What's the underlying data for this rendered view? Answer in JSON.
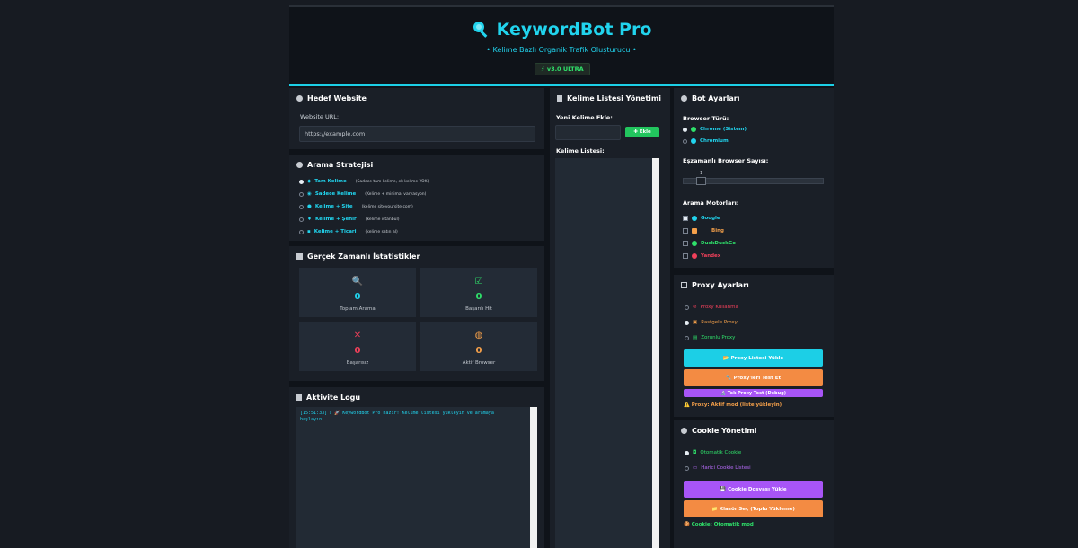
{
  "app": {
    "title": "KeywordBot Pro",
    "subtitle": "• Kelime Bazlı Organik Trafik Oluşturucu •",
    "version": "⚡ v3.0 ULTRA",
    "accent": "#21d4ee"
  },
  "target": {
    "title": "Hedef Website",
    "url_label": "Website URL:",
    "url_value": "https://example.com"
  },
  "strategy": {
    "title": "Arama Stratejisi",
    "options": [
      {
        "label": "Tam Kelime",
        "desc": "(Sadece tam kelime, ek kelime YOK)",
        "selected": true
      },
      {
        "label": "Sadece Kelime",
        "desc": "(Kelime + minimal varyasyon)",
        "selected": false
      },
      {
        "label": "Kelime + Site",
        "desc": "(kelime siteyoursite.com)",
        "selected": false
      },
      {
        "label": "Kelime + Şehir",
        "desc": "(kelime istanbul)",
        "selected": false
      },
      {
        "label": "Kelime + Ticari",
        "desc": "(kelime satın al)",
        "selected": false
      }
    ]
  },
  "stats": {
    "title": "Gerçek Zamanlı İstatistikler",
    "items": [
      {
        "label": "Toplam Arama",
        "value": "0",
        "color": "#21d4ee",
        "icon": "magnifier-icon"
      },
      {
        "label": "Başarılı Hit",
        "value": "0",
        "color": "#2fe06a",
        "icon": "check-box-icon"
      },
      {
        "label": "Başarısız",
        "value": "0",
        "color": "#f0405a",
        "icon": "cross-icon"
      },
      {
        "label": "Aktif Browser",
        "value": "0",
        "color": "#f5a04a",
        "icon": "globe-icon"
      }
    ]
  },
  "log": {
    "title": "Aktivite Logu",
    "line1": "[15:51:33] ℹ    🚀 KeywordBot Pro hazır! Kelime listesi yükleyin ve aramaya",
    "line2": "başlayın."
  },
  "keywords": {
    "title": "Kelime Listesi Yönetimi",
    "add_label": "Yeni Kelime Ekle:",
    "add_value": "",
    "add_button": "✚ Ekle",
    "list_label": "Kelime Listesi:"
  },
  "bot": {
    "title": "Bot Ayarları",
    "browser_type_label": "Browser Türü:",
    "browsers": [
      {
        "label": "Chrome (Sistem)",
        "selected": true
      },
      {
        "label": "Chromium",
        "selected": false
      }
    ],
    "concurrent_label": "Eşzamanlı Browser Sayısı:",
    "concurrent_value": "1",
    "concurrent_fraction": 0.0,
    "engines_label": "Arama Motorları:",
    "engines": [
      {
        "label": "Google",
        "checked": true,
        "color": "#21d4ee"
      },
      {
        "label": "Bing",
        "checked": false,
        "color": "#f5a04a"
      },
      {
        "label": "DuckDuckGo",
        "checked": false,
        "color": "#2fe06a"
      },
      {
        "label": "Yandex",
        "checked": false,
        "color": "#f0405a"
      }
    ]
  },
  "proxy": {
    "title": "Proxy Ayarları",
    "options": [
      {
        "label": "Proxy Kullanma",
        "selected": false,
        "color": "#f0405a"
      },
      {
        "label": "Rastgele Proxy",
        "selected": true,
        "color": "#f5a04a"
      },
      {
        "label": "Zorunlu Proxy",
        "selected": false,
        "color": "#2fe06a"
      }
    ],
    "load_button": "📂 Proxy Listesi Yükle",
    "test_button": "🔧 Proxy'leri Test Et",
    "debug_button": "🔬 Tek Proxy Test (Debug)",
    "status": "⚠️ Proxy: Aktif mod (liste yükleyin)"
  },
  "cookie": {
    "title": "Cookie Yönetimi",
    "options": [
      {
        "label": "Otomatik Cookie",
        "selected": true,
        "color": "#2fe06a"
      },
      {
        "label": "Harici Cookie Listesi",
        "selected": false,
        "color": "#b469f5"
      }
    ],
    "load_button": "💾 Cookie Dosyası Yükle",
    "folder_button": "📁 Klasör Seç (Toplu Yükleme)",
    "status": "🍪 Cookie: Otomatik mod"
  }
}
